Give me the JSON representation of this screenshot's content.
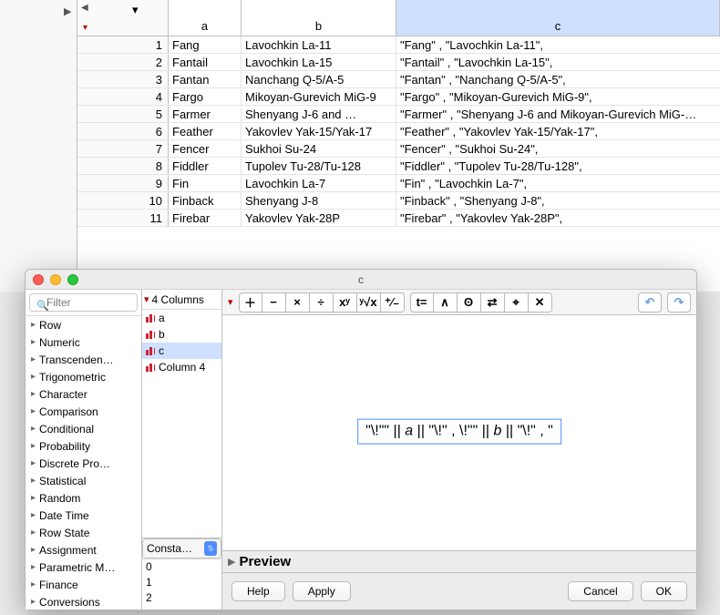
{
  "columns": {
    "a": "a",
    "b": "b",
    "c": "c"
  },
  "rows": [
    {
      "n": "1",
      "a": "Fang",
      "b": "Lavochkin La-11",
      "c": "\"Fang\" , \"Lavochkin La-11\","
    },
    {
      "n": "2",
      "a": "Fantail",
      "b": "Lavochkin La-15",
      "c": "\"Fantail\" , \"Lavochkin La-15\","
    },
    {
      "n": "3",
      "a": "Fantan",
      "b": "Nanchang Q-5/A-5",
      "c": "\"Fantan\" , \"Nanchang Q-5/A-5\","
    },
    {
      "n": "4",
      "a": "Fargo",
      "b": "Mikoyan-Gurevich MiG-9",
      "c": "\"Fargo\" , \"Mikoyan-Gurevich MiG-9\","
    },
    {
      "n": "5",
      "a": "Farmer",
      "b": "Shenyang J-6 and …",
      "c": "\"Farmer\" , \"Shenyang J-6 and Mikoyan-Gurevich MiG-…"
    },
    {
      "n": "6",
      "a": "Feather",
      "b": "Yakovlev Yak-15/Yak-17",
      "c": "\"Feather\" , \"Yakovlev Yak-15/Yak-17\","
    },
    {
      "n": "7",
      "a": "Fencer",
      "b": "Sukhoi Su-24",
      "c": "\"Fencer\" , \"Sukhoi Su-24\","
    },
    {
      "n": "8",
      "a": "Fiddler",
      "b": "Tupolev Tu-28/Tu-128",
      "c": "\"Fiddler\" , \"Tupolev Tu-28/Tu-128\","
    },
    {
      "n": "9",
      "a": "Fin",
      "b": "Lavochkin La-7",
      "c": "\"Fin\" , \"Lavochkin La-7\","
    },
    {
      "n": "10",
      "a": "Finback",
      "b": "Shenyang J-8",
      "c": "\"Finback\" , \"Shenyang J-8\","
    },
    {
      "n": "11",
      "a": "Firebar",
      "b": "Yakovlev Yak-28P",
      "c": "\"Firebar\" , \"Yakovlev Yak-28P\","
    }
  ],
  "dialog": {
    "title": "c",
    "filter_placeholder": "Filter",
    "categories": [
      "Row",
      "Numeric",
      "Transcenden…",
      "Trigonometric",
      "Character",
      "Comparison",
      "Conditional",
      "Probability",
      "Discrete Pro…",
      "Statistical",
      "Random",
      "Date Time",
      "Row State",
      "Assignment",
      "Parametric M…",
      "Finance",
      "Conversions"
    ],
    "columns_header": "4 Columns",
    "column_items": [
      "a",
      "b",
      "c",
      "Column 4"
    ],
    "selected_column": "c",
    "constants_label": "Consta…",
    "constants": [
      "0",
      "1",
      "2"
    ],
    "toolbar_ops": [
      "＋",
      "−",
      "×",
      "÷",
      "xʸ",
      "ʸ√x",
      "⁺∕₋"
    ],
    "toolbar_grp2": [
      "t=",
      "∧",
      "ʘ",
      "⇄",
      "⌖",
      "✕"
    ],
    "formula_parts": [
      "\"\\!\"\" || ",
      " || \"\\!\" , \\!\"\" || ",
      " || \"\\!\" , \""
    ],
    "formula_vars": [
      "a",
      "b"
    ],
    "preview_label": "Preview",
    "buttons": {
      "help": "Help",
      "apply": "Apply",
      "cancel": "Cancel",
      "ok": "OK"
    }
  }
}
